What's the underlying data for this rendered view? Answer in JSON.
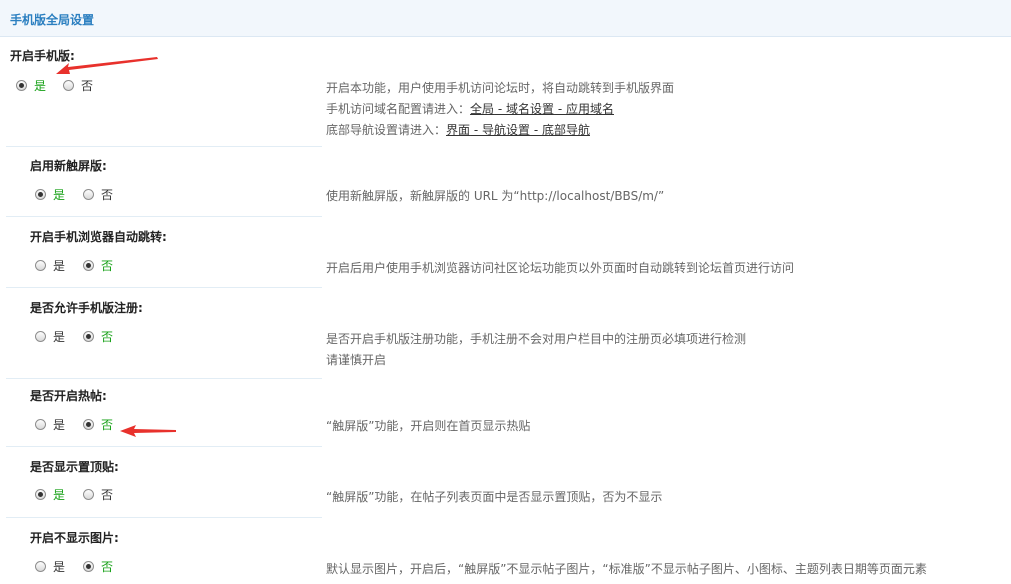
{
  "header": {
    "title": "手机版全局设置"
  },
  "settings": [
    {
      "label": "开启手机版:",
      "yes": "是",
      "no": "否",
      "selected": "yes",
      "desc1": "开启本功能，用户使用手机访问论坛时，将自动跳转到手机版界面",
      "desc2_prefix": "手机访问域名配置请进入：",
      "desc2_links": [
        "全局",
        "域名设置",
        "应用域名"
      ],
      "desc3_prefix": "底部导航设置请进入：",
      "desc3_links": [
        "界面",
        "导航设置",
        "底部导航"
      ],
      "sep": " - "
    },
    {
      "label": "启用新触屏版:",
      "yes": "是",
      "no": "否",
      "selected": "yes",
      "desc1": "使用新触屏版，新触屏版的 URL 为“http://localhost/BBS/m/”"
    },
    {
      "label": "开启手机浏览器自动跳转:",
      "yes": "是",
      "no": "否",
      "selected": "no",
      "desc1": "开启后用户使用手机浏览器访问社区论坛功能页以外页面时自动跳转到论坛首页进行访问"
    },
    {
      "label": "是否允许手机版注册:",
      "yes": "是",
      "no": "否",
      "selected": "no",
      "desc1": "是否开启手机版注册功能，手机注册不会对用户栏目中的注册页必填项进行检测",
      "desc2": "请谨慎开启"
    },
    {
      "label": "是否开启热帖:",
      "yes": "是",
      "no": "否",
      "selected": "no",
      "desc1": "“触屏版”功能，开启则在首页显示热贴"
    },
    {
      "label": "是否显示置顶贴:",
      "yes": "是",
      "no": "否",
      "selected": "yes",
      "desc1": "“触屏版”功能，在帖子列表页面中是否显示置顶贴，否为不显示"
    },
    {
      "label": "开启不显示图片:",
      "yes": "是",
      "no": "否",
      "selected": "no",
      "desc1": "默认显示图片，开启后，“触屏版”不显示帖子图片，“标准版”不显示帖子图片、小图标、主题列表日期等页面元素"
    }
  ],
  "colors": {
    "accent": "#2b7fc0",
    "selected_text": "#15a015",
    "arrow": "#e8312c"
  }
}
